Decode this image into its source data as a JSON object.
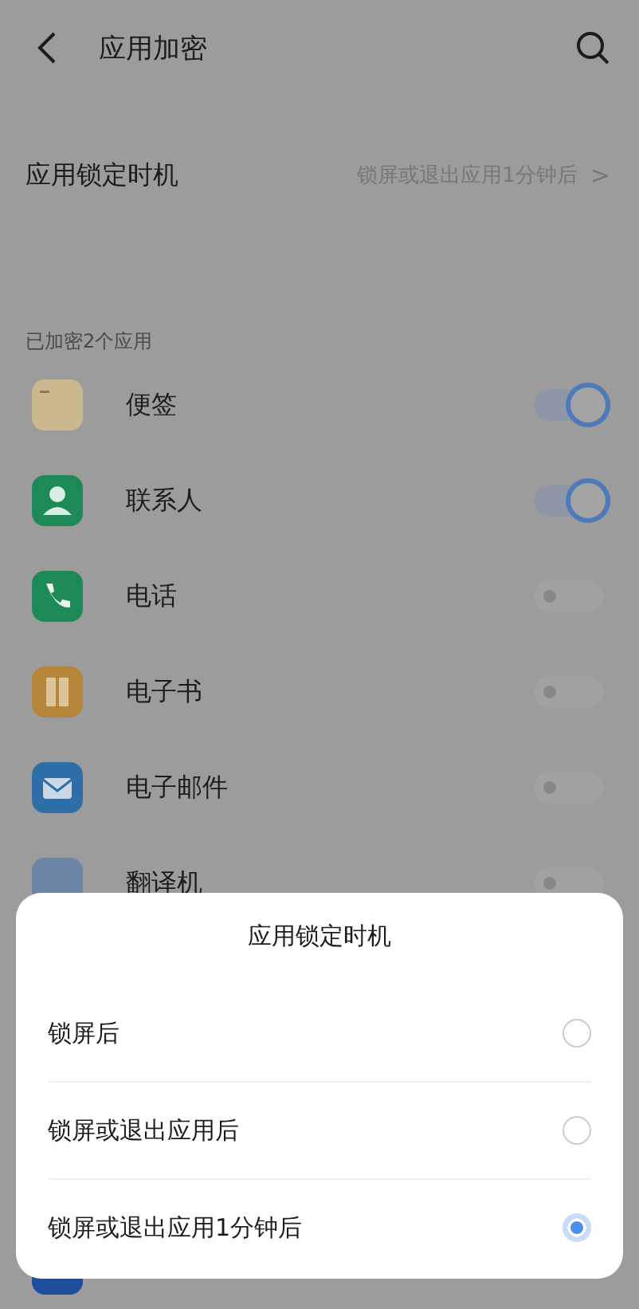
{
  "header": {
    "title": "应用加密"
  },
  "lock_timing": {
    "label": "应用锁定时机",
    "value": "锁屏或退出应用1分钟后",
    "chevron": ">"
  },
  "section_label": "已加密2个应用",
  "apps": [
    {
      "name": "便签",
      "kind": "notes",
      "on": true
    },
    {
      "name": "联系人",
      "kind": "contacts",
      "on": true
    },
    {
      "name": "电话",
      "kind": "phone",
      "on": false
    },
    {
      "name": "电子书",
      "kind": "ebook",
      "on": false
    },
    {
      "name": "电子邮件",
      "kind": "mail",
      "on": false
    },
    {
      "name": "翻译机",
      "kind": "translator",
      "on": false
    }
  ],
  "sheet": {
    "title": "应用锁定时机",
    "options": [
      {
        "label": "锁屏后",
        "selected": false
      },
      {
        "label": "锁屏或退出应用后",
        "selected": false
      },
      {
        "label": "锁屏或退出应用1分钟后",
        "selected": true
      }
    ]
  }
}
